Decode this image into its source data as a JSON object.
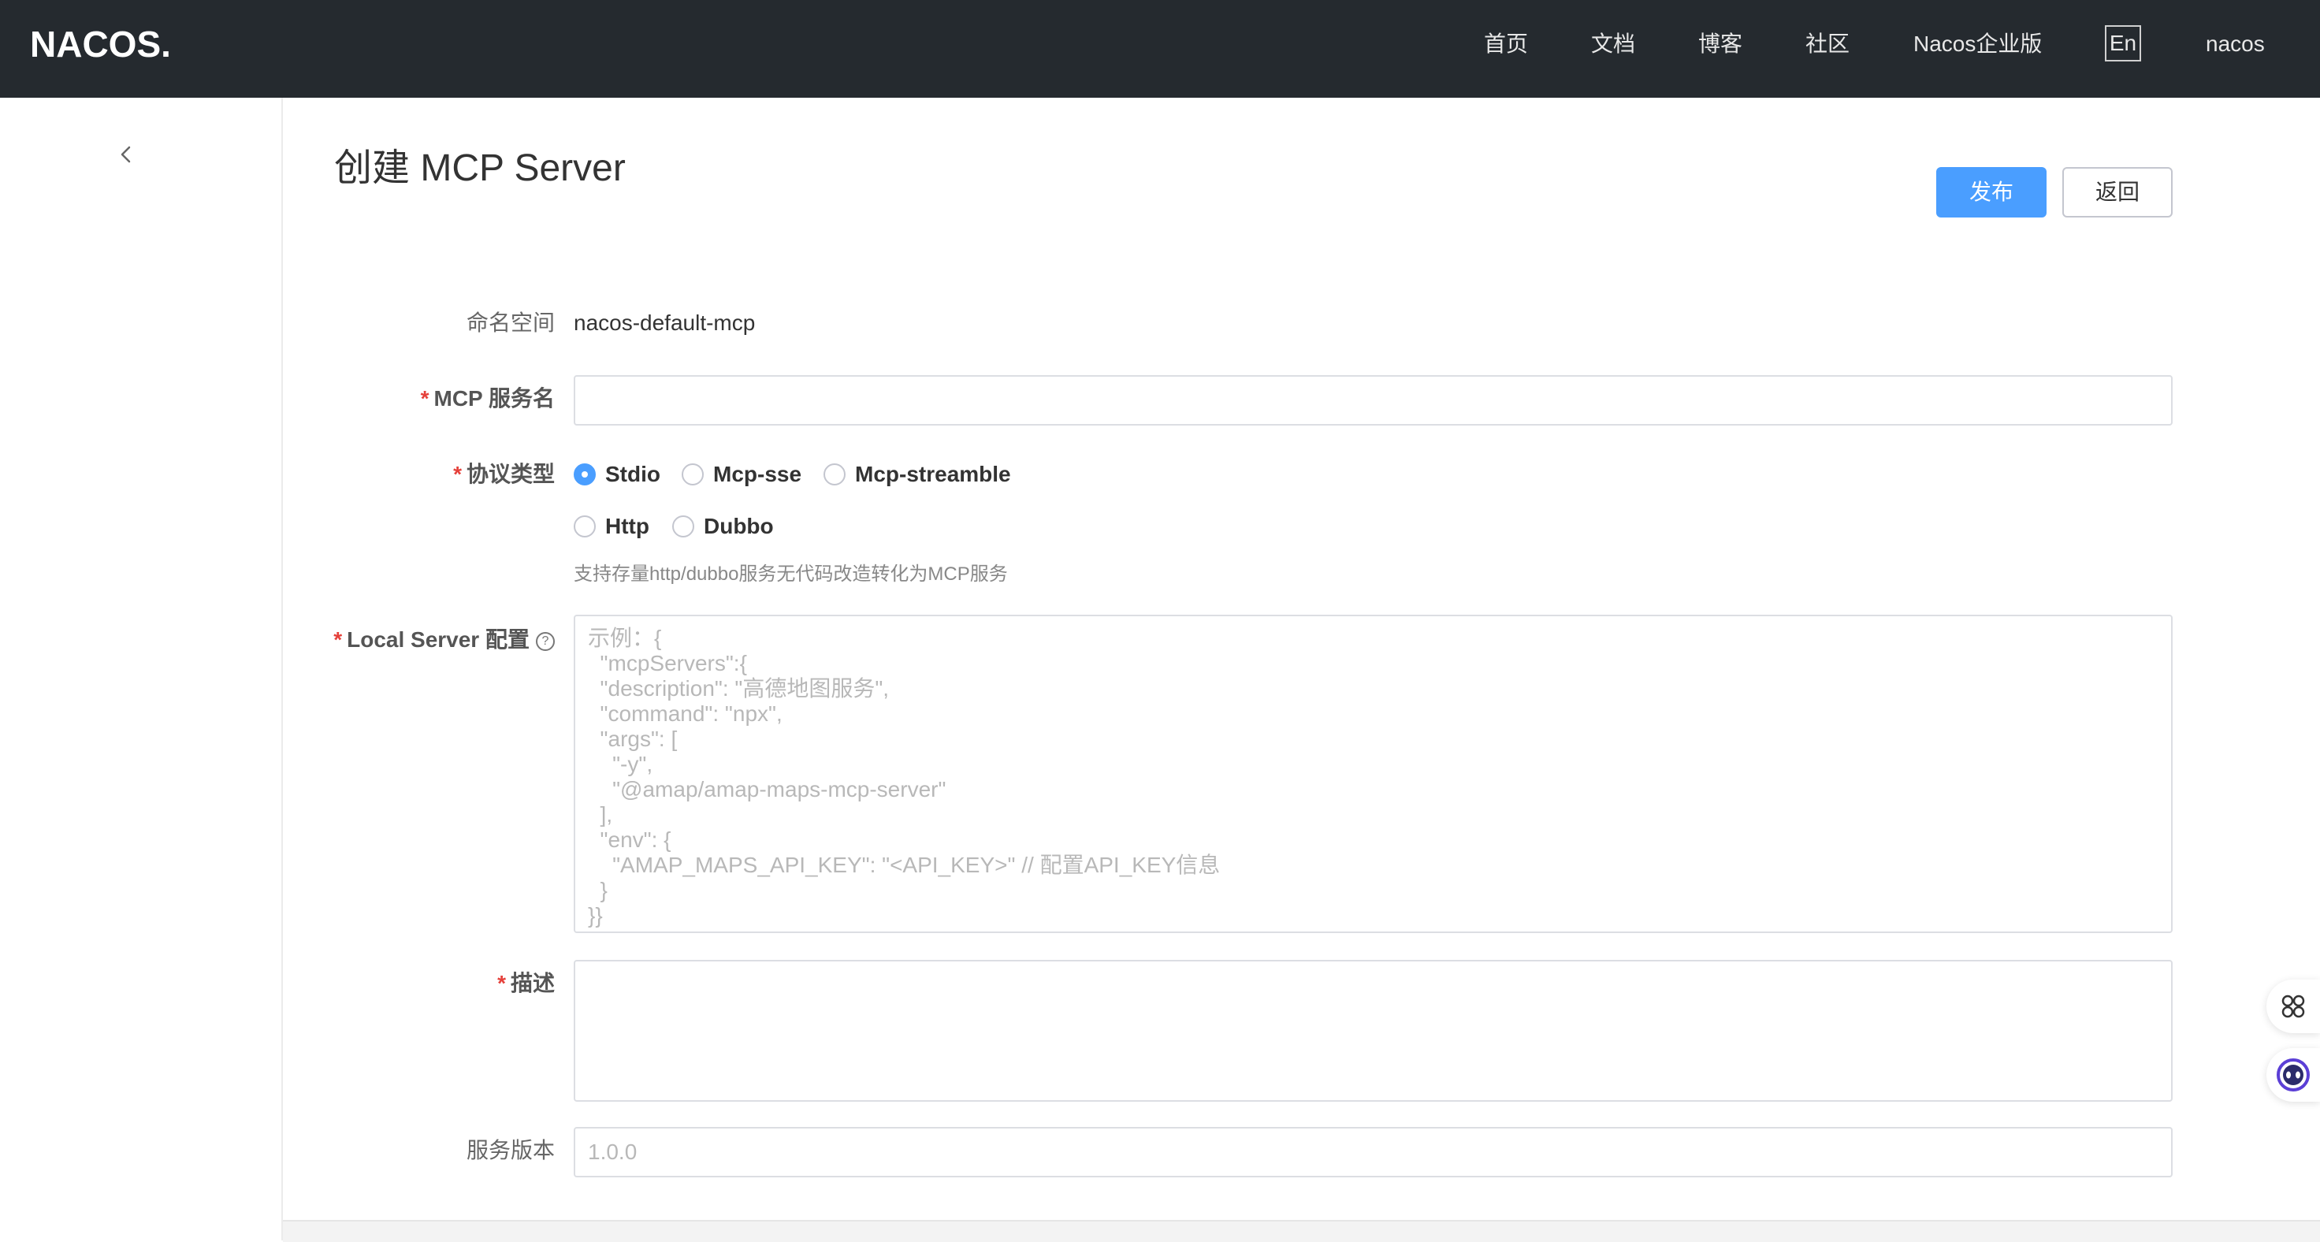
{
  "header": {
    "logo_text": "NACOS.",
    "nav": [
      {
        "label": "首页"
      },
      {
        "label": "文档"
      },
      {
        "label": "博客"
      },
      {
        "label": "社区"
      },
      {
        "label": "Nacos企业版"
      }
    ],
    "lang_label": "En",
    "user_label": "nacos"
  },
  "page": {
    "title": "创建 MCP Server",
    "publish_label": "发布",
    "back_label": "返回"
  },
  "form": {
    "namespace": {
      "label": "命名空间",
      "value": "nacos-default-mcp"
    },
    "service_name": {
      "label": "MCP 服务名",
      "value": "",
      "placeholder": ""
    },
    "protocol": {
      "label": "协议类型",
      "options": [
        {
          "label": "Stdio",
          "checked": true
        },
        {
          "label": "Mcp-sse",
          "checked": false
        },
        {
          "label": "Mcp-streamble",
          "checked": false
        },
        {
          "label": "Http",
          "checked": false
        },
        {
          "label": "Dubbo",
          "checked": false
        }
      ],
      "help": "支持存量http/dubbo服务无代码改造转化为MCP服务"
    },
    "local_server": {
      "label": "Local Server 配置",
      "help_icon": "?",
      "placeholder": "示例：{\n  \"mcpServers\":{\n  \"description\": \"高德地图服务\",\n  \"command\": \"npx\",\n  \"args\": [\n    \"-y\",\n    \"@amap/amap-maps-mcp-server\"\n  ],\n  \"env\": {\n    \"AMAP_MAPS_API_KEY\": \"<API_KEY>\" // 配置API_KEY信息\n  }\n}}"
    },
    "description": {
      "label": "描述",
      "value": ""
    },
    "version": {
      "label": "服务版本",
      "placeholder": "1.0.0"
    }
  },
  "colors": {
    "header_bg": "#252a2f",
    "primary": "#4a9eff",
    "required": "#e5403a"
  },
  "icons": {
    "collapse": "chevron-left-icon",
    "float_top": "apps-grid-icon",
    "float_bottom": "assistant-bot-icon"
  }
}
